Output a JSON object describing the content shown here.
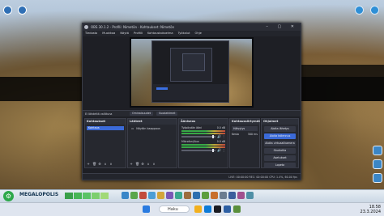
{
  "window": {
    "title": "OBS 30.1.2 - Profili: Nimetön - Kohtaukset: Nimetön",
    "controls": "– ▢ ✕"
  },
  "menu": [
    "Tiedosto",
    "Muokkaa",
    "Näytä",
    "Profiili",
    "Kohtauskokoelma",
    "Työkalut",
    "Ohje"
  ],
  "context_bar": {
    "label": "Ei lähdettä valittuna",
    "buttons": [
      "Ominaisuudet",
      "Suodattimet"
    ]
  },
  "docks": {
    "scenes": {
      "title": "Kohtaukset",
      "items": [
        "Kohtaus"
      ]
    },
    "sources": {
      "title": "Lähteet",
      "items": [
        "Näytön kaappaus"
      ]
    },
    "mixer": {
      "title": "Ääniseos",
      "channels": [
        {
          "name": "Työpöydän ääni",
          "level": "0.0 dB"
        },
        {
          "name": "Mikrofoni/Aux",
          "level": "0.0 dB"
        }
      ]
    },
    "transitions": {
      "title": "Kohtaussiirtymät",
      "selected": "Häivytys",
      "duration_label": "Kesto",
      "duration": "300 ms"
    },
    "controls": {
      "title": "Ohjaimet",
      "buttons": [
        "Aloita lähetys",
        "Aloita tallennus",
        "Aloita virtuaalikamera",
        "Studiotila",
        "Asetukset",
        "Lopeta"
      ]
    }
  },
  "status": "LIVE: 00:00:00   REC: 00:00:00   CPU: 1.4%, 60.00 fps",
  "game": {
    "city": "MEGALOPOLIS",
    "population_level": 0.7
  },
  "taskbar": {
    "search": "Haku",
    "time": "18.58",
    "date": "23.3.2024"
  },
  "colors": {
    "accent": "#3b6ad8",
    "obs_bg": "#1e1f25",
    "game_bar": "#e6edf4"
  }
}
